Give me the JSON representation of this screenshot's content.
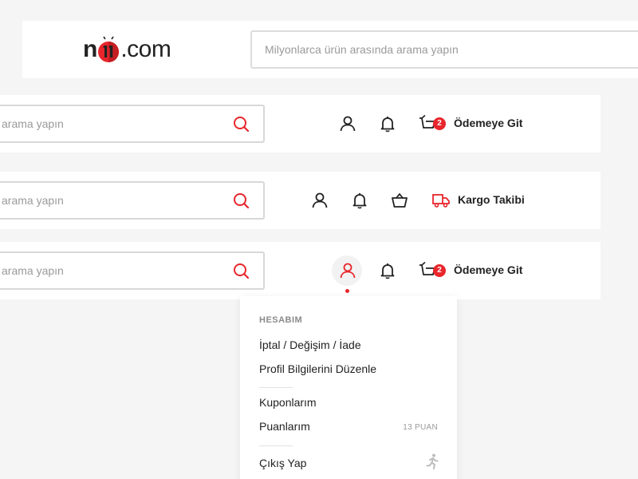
{
  "header": {
    "logo": {
      "prefix": "n",
      "suffix": ".com"
    },
    "search": {
      "placeholder": "Milyonlarca ürün arasında arama yapın"
    }
  },
  "bars": [
    {
      "search_text": "arama yapın",
      "cart_badge": "2",
      "action_label": "Ödemeye Git"
    },
    {
      "search_text": "arama yapın",
      "action_label": "Kargo Takibi"
    },
    {
      "search_text": "arama yapın",
      "cart_badge": "2",
      "action_label": "Ödemeye Git"
    }
  ],
  "icons": {
    "search": "search-icon",
    "user": "user-icon",
    "bell": "bell-icon",
    "cart": "cart-icon",
    "basket": "basket-icon",
    "truck": "truck-icon",
    "logout": "running-person-icon"
  },
  "dropdown": {
    "heading": "HESABIM",
    "items": [
      {
        "label": "İptal / Değişim / İade"
      },
      {
        "label": "Profil Bilgilerini Düzenle"
      },
      {
        "label": "Kuponlarım"
      },
      {
        "label": "Puanlarım",
        "meta": "13 PUAN"
      },
      {
        "label": "Çıkış Yap"
      }
    ]
  },
  "colors": {
    "accent": "#e8262c",
    "text": "#222222",
    "muted": "#9a9a9a",
    "background": "#f5f5f5"
  }
}
